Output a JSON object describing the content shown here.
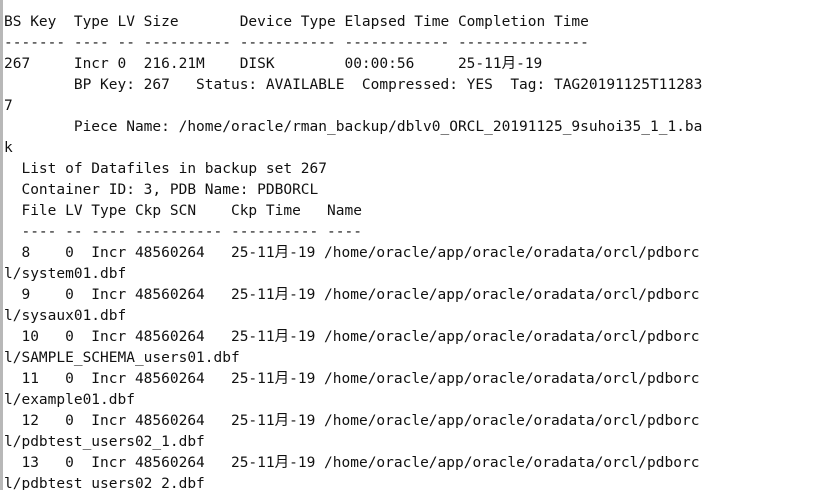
{
  "terminal": {
    "lines": [
      "BS Key  Type LV Size       Device Type Elapsed Time Completion Time",
      "------- ---- -- ---------- ----------- ------------ ---------------",
      "267     Incr 0  216.21M    DISK        00:00:56     25-11月-19",
      "        BP Key: 267   Status: AVAILABLE  Compressed: YES  Tag: TAG20191125T11283",
      "7",
      "        Piece Name: /home/oracle/rman_backup/dblv0_ORCL_20191125_9suhoi35_1_1.ba",
      "k",
      "  List of Datafiles in backup set 267",
      "  Container ID: 3, PDB Name: PDBORCL",
      "  File LV Type Ckp SCN    Ckp Time   Name",
      "  ---- -- ---- ---------- ---------- ----",
      "  8    0  Incr 48560264   25-11月-19 /home/oracle/app/oracle/oradata/orcl/pdborc",
      "l/system01.dbf",
      "  9    0  Incr 48560264   25-11月-19 /home/oracle/app/oracle/oradata/orcl/pdborc",
      "l/sysaux01.dbf",
      "  10   0  Incr 48560264   25-11月-19 /home/oracle/app/oracle/oradata/orcl/pdborc",
      "l/SAMPLE_SCHEMA_users01.dbf",
      "  11   0  Incr 48560264   25-11月-19 /home/oracle/app/oracle/oradata/orcl/pdborc",
      "l/example01.dbf",
      "  12   0  Incr 48560264   25-11月-19 /home/oracle/app/oracle/oradata/orcl/pdborc",
      "l/pdbtest_users02_1.dbf",
      "  13   0  Incr 48560264   25-11月-19 /home/oracle/app/oracle/oradata/orcl/pdborc",
      "l/pdbtest_users02_2.dbf"
    ]
  }
}
